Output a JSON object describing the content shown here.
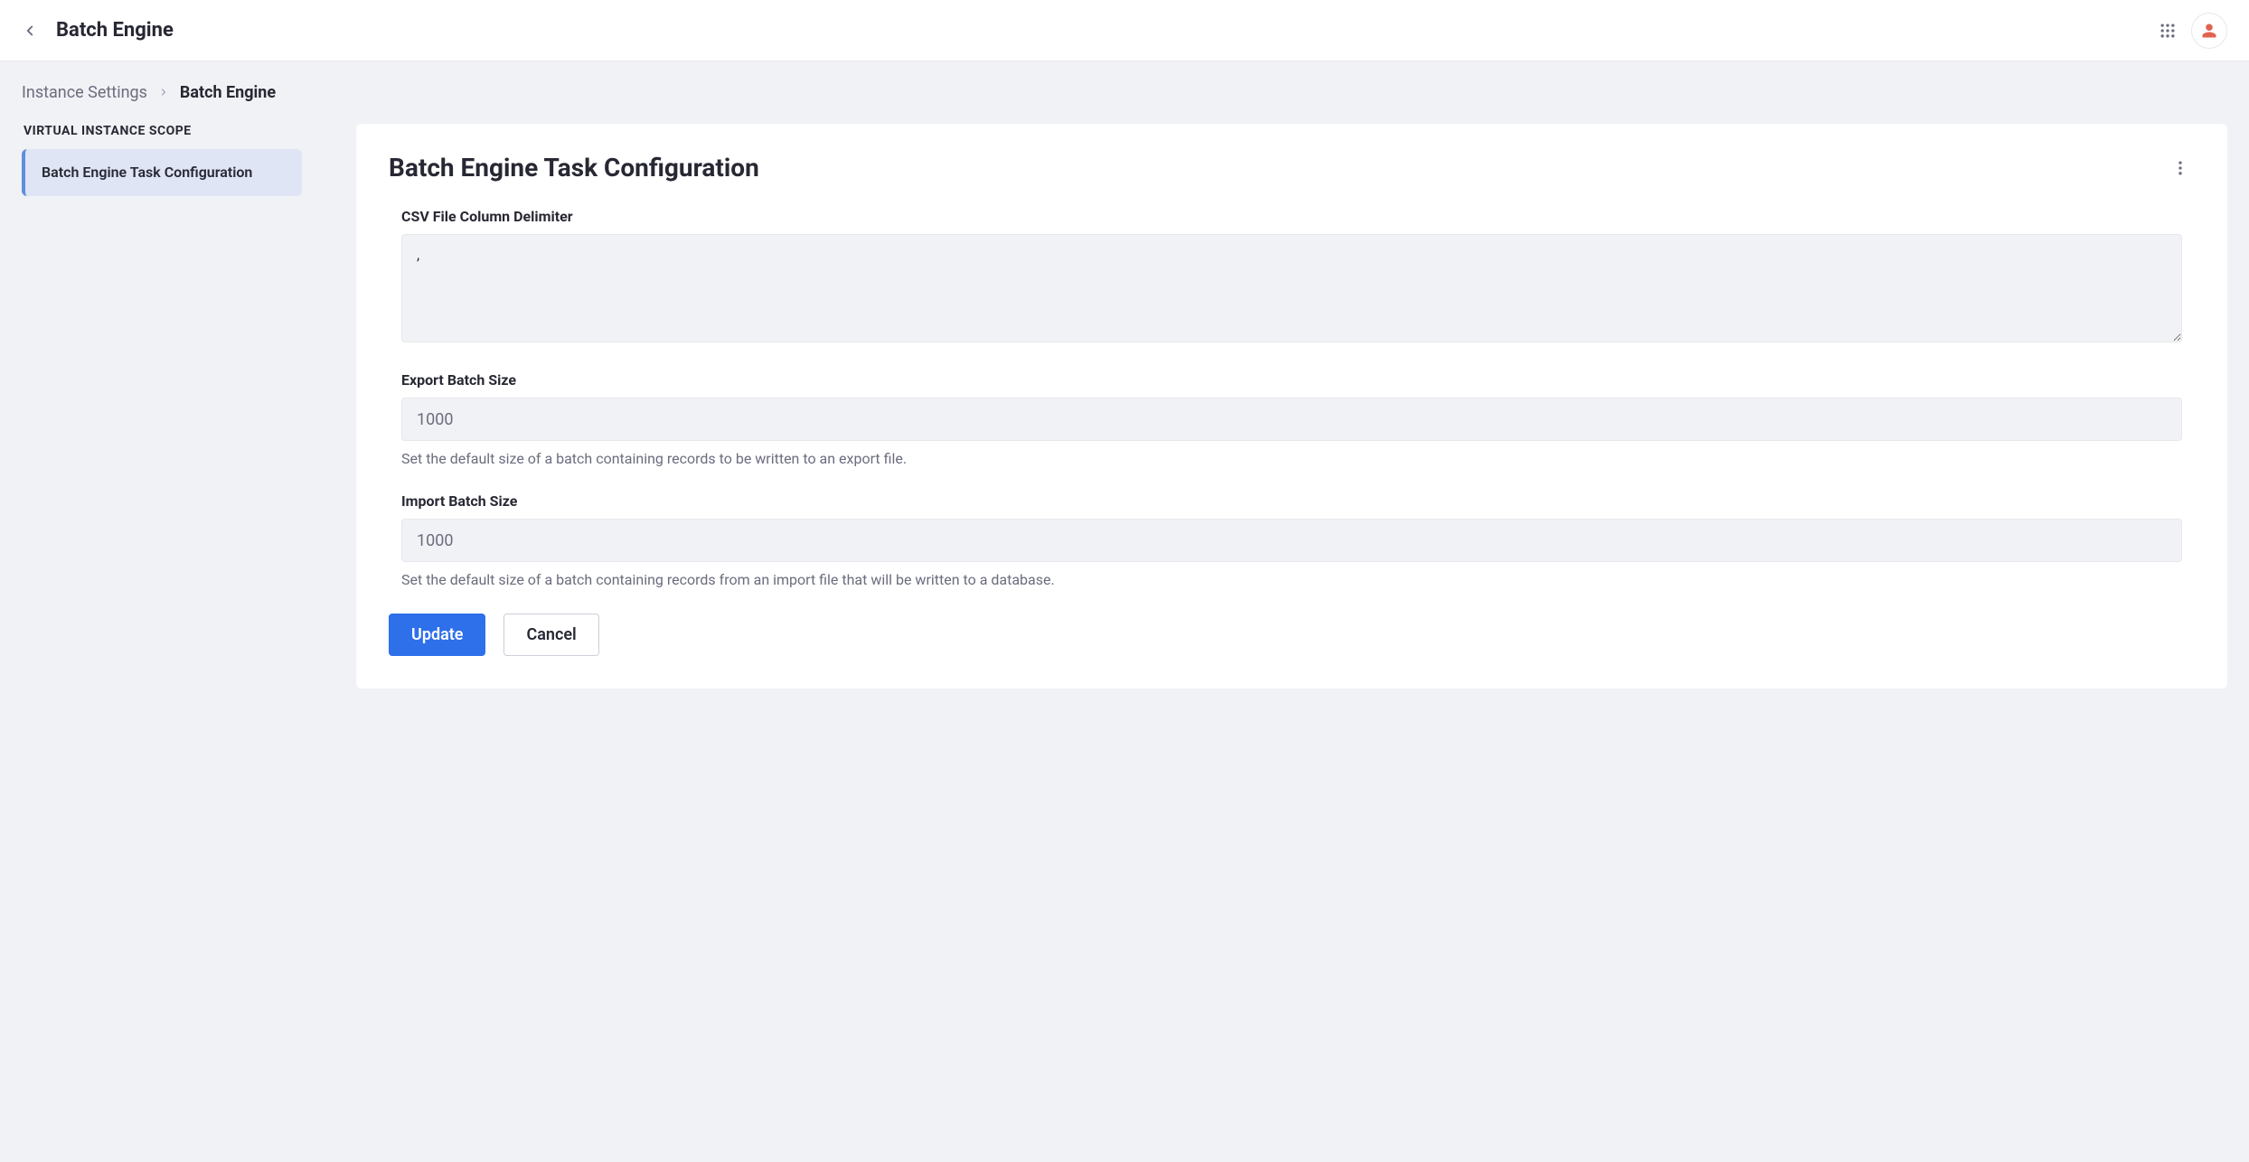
{
  "topbar": {
    "title": "Batch Engine"
  },
  "breadcrumb": {
    "parent": "Instance Settings",
    "current": "Batch Engine"
  },
  "sidebar": {
    "heading": "Virtual Instance Scope",
    "items": [
      {
        "label": "Batch Engine Task Configuration"
      }
    ]
  },
  "panel": {
    "title": "Batch Engine Task Configuration",
    "fields": {
      "csv_delimiter": {
        "label": "CSV File Column Delimiter",
        "value": ","
      },
      "export_batch_size": {
        "label": "Export Batch Size",
        "value": "1000",
        "help": "Set the default size of a batch containing records to be written to an export file."
      },
      "import_batch_size": {
        "label": "Import Batch Size",
        "value": "1000",
        "help": "Set the default size of a batch containing records from an import file that will be written to a database."
      }
    },
    "buttons": {
      "update": "Update",
      "cancel": "Cancel"
    }
  }
}
